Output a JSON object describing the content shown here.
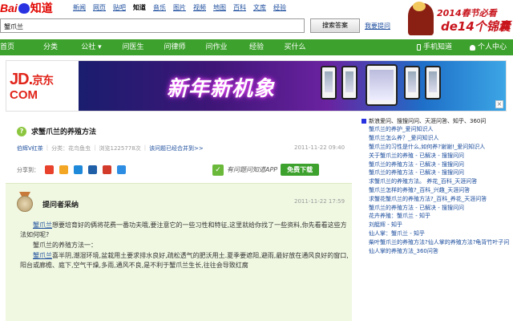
{
  "header": {
    "logo_bai": "Bai",
    "logo_zhidao": "知道",
    "nav": [
      {
        "label": "新闻",
        "active": false
      },
      {
        "label": "网页",
        "active": false
      },
      {
        "label": "贴吧",
        "active": false
      },
      {
        "label": "知道",
        "active": true
      },
      {
        "label": "音乐",
        "active": false
      },
      {
        "label": "图片",
        "active": false
      },
      {
        "label": "视频",
        "active": false
      },
      {
        "label": "地图",
        "active": false
      },
      {
        "label": "百科",
        "active": false
      },
      {
        "label": "文库",
        "active": false
      },
      {
        "label": "经验",
        "active": false
      }
    ],
    "search_value": "蟹爪兰",
    "search_button": "搜索答案",
    "ask_link": "我要提问",
    "promo_line1": "2014春节必看",
    "promo_line2": "de14个锦囊"
  },
  "greennav": {
    "items": [
      "首页",
      "分类",
      "公社",
      "问医生",
      "问律师",
      "问作业",
      "经验",
      "买什么"
    ],
    "dropdown_index": 2,
    "right": [
      "手机知道",
      "个人中心"
    ]
  },
  "banner": {
    "jd_line1": "JD.",
    "jd_cn": "京东",
    "jd_line2": "COM",
    "slogan": "新年新机象",
    "close": "×"
  },
  "question": {
    "title": "求蟹爪兰的养殖方法",
    "user": "伯辉V红茶",
    "category": "分类：花鸟鱼虫",
    "views": "浏览1225778次",
    "recommended": "该问题已经合并到>>",
    "time": "2011-11-22 09:40"
  },
  "share": {
    "label": "分享到：",
    "icons": [
      {
        "name": "tencent-weibo-icon",
        "color": "#e8412c"
      },
      {
        "name": "qzone-icon",
        "color": "#f2a623"
      },
      {
        "name": "qq-icon",
        "color": "#1e88d9"
      },
      {
        "name": "renren-icon",
        "color": "#1f5fa8"
      },
      {
        "name": "kaixin-icon",
        "color": "#d23b2a"
      },
      {
        "name": "baidu-share-icon",
        "color": "#2d8de3"
      }
    ]
  },
  "app_promo": {
    "text": "有问题问知道APP",
    "button": "免费下载"
  },
  "answer": {
    "label": "提问者采纳",
    "time": "2011-11-22 17:59",
    "paragraphs": [
      {
        "kw": "蟹爪兰",
        "text": "想要培育好的俩将花费一番功夫哦,要注意它的一些习性和特征,这里就给你找了一些资料,你先看看这些方法如何呢?"
      },
      {
        "kw": "",
        "text": "蟹爪兰的养殖方法一："
      },
      {
        "kw": "蟹爪兰",
        "text": "喜半阴,潮湿环境,盆栽用土要求排水良好,疏松透气的肥沃用土.夏季要遮阳,避雨,最好放在通风良好的窗口,阳台或廊檐、庭下,空气干燥,多雨,通风不良,是不利于蟹爪兰生长,往往会导致红腐"
      }
    ]
  },
  "sidebar": {
    "header": "新浪爱问、搜搜问问、天涯问答、知乎、360问",
    "items": [
      "蟹爪兰的养护_爱问知识人",
      "蟹爪兰怎么养？_爱问知识人",
      "蟹爪兰的习性是什么,如何养?谢谢!_爱问知识人",
      "关于蟹爪兰的养殖 - 已解决 - 搜搜问问",
      "蟹爪兰的养殖方法 - 已解决 - 搜搜问问",
      "蟹爪兰的养殖方法 - 已解决 - 搜搜问问",
      "求蟹爪兰的养殖方法。 养花_百科_天涯问答",
      "蟹爪兰怎样的养殖?_百科_兴趣_天涯问答",
      "求蟹花蟹爪兰的养殖方法?_百科_养花_天涯问答",
      "蟹爪兰的养殖方法 - 已解决 - 搜搜问问",
      "花卉养殖：蟹爪兰 - 知乎",
      "刘艇辉 - 知乎",
      "仙人掌：蟹爪兰 - 知乎",
      "柴叶蟹爪兰的养殖方法?仙人掌的养殖方法?龟背竹叶子问",
      "仙人掌的养殖方法_360问答"
    ]
  },
  "colors": {
    "green": "#3da12d",
    "link": "#1a4b9c",
    "baidu_red": "#e10602",
    "baidu_blue": "#2932e1"
  }
}
